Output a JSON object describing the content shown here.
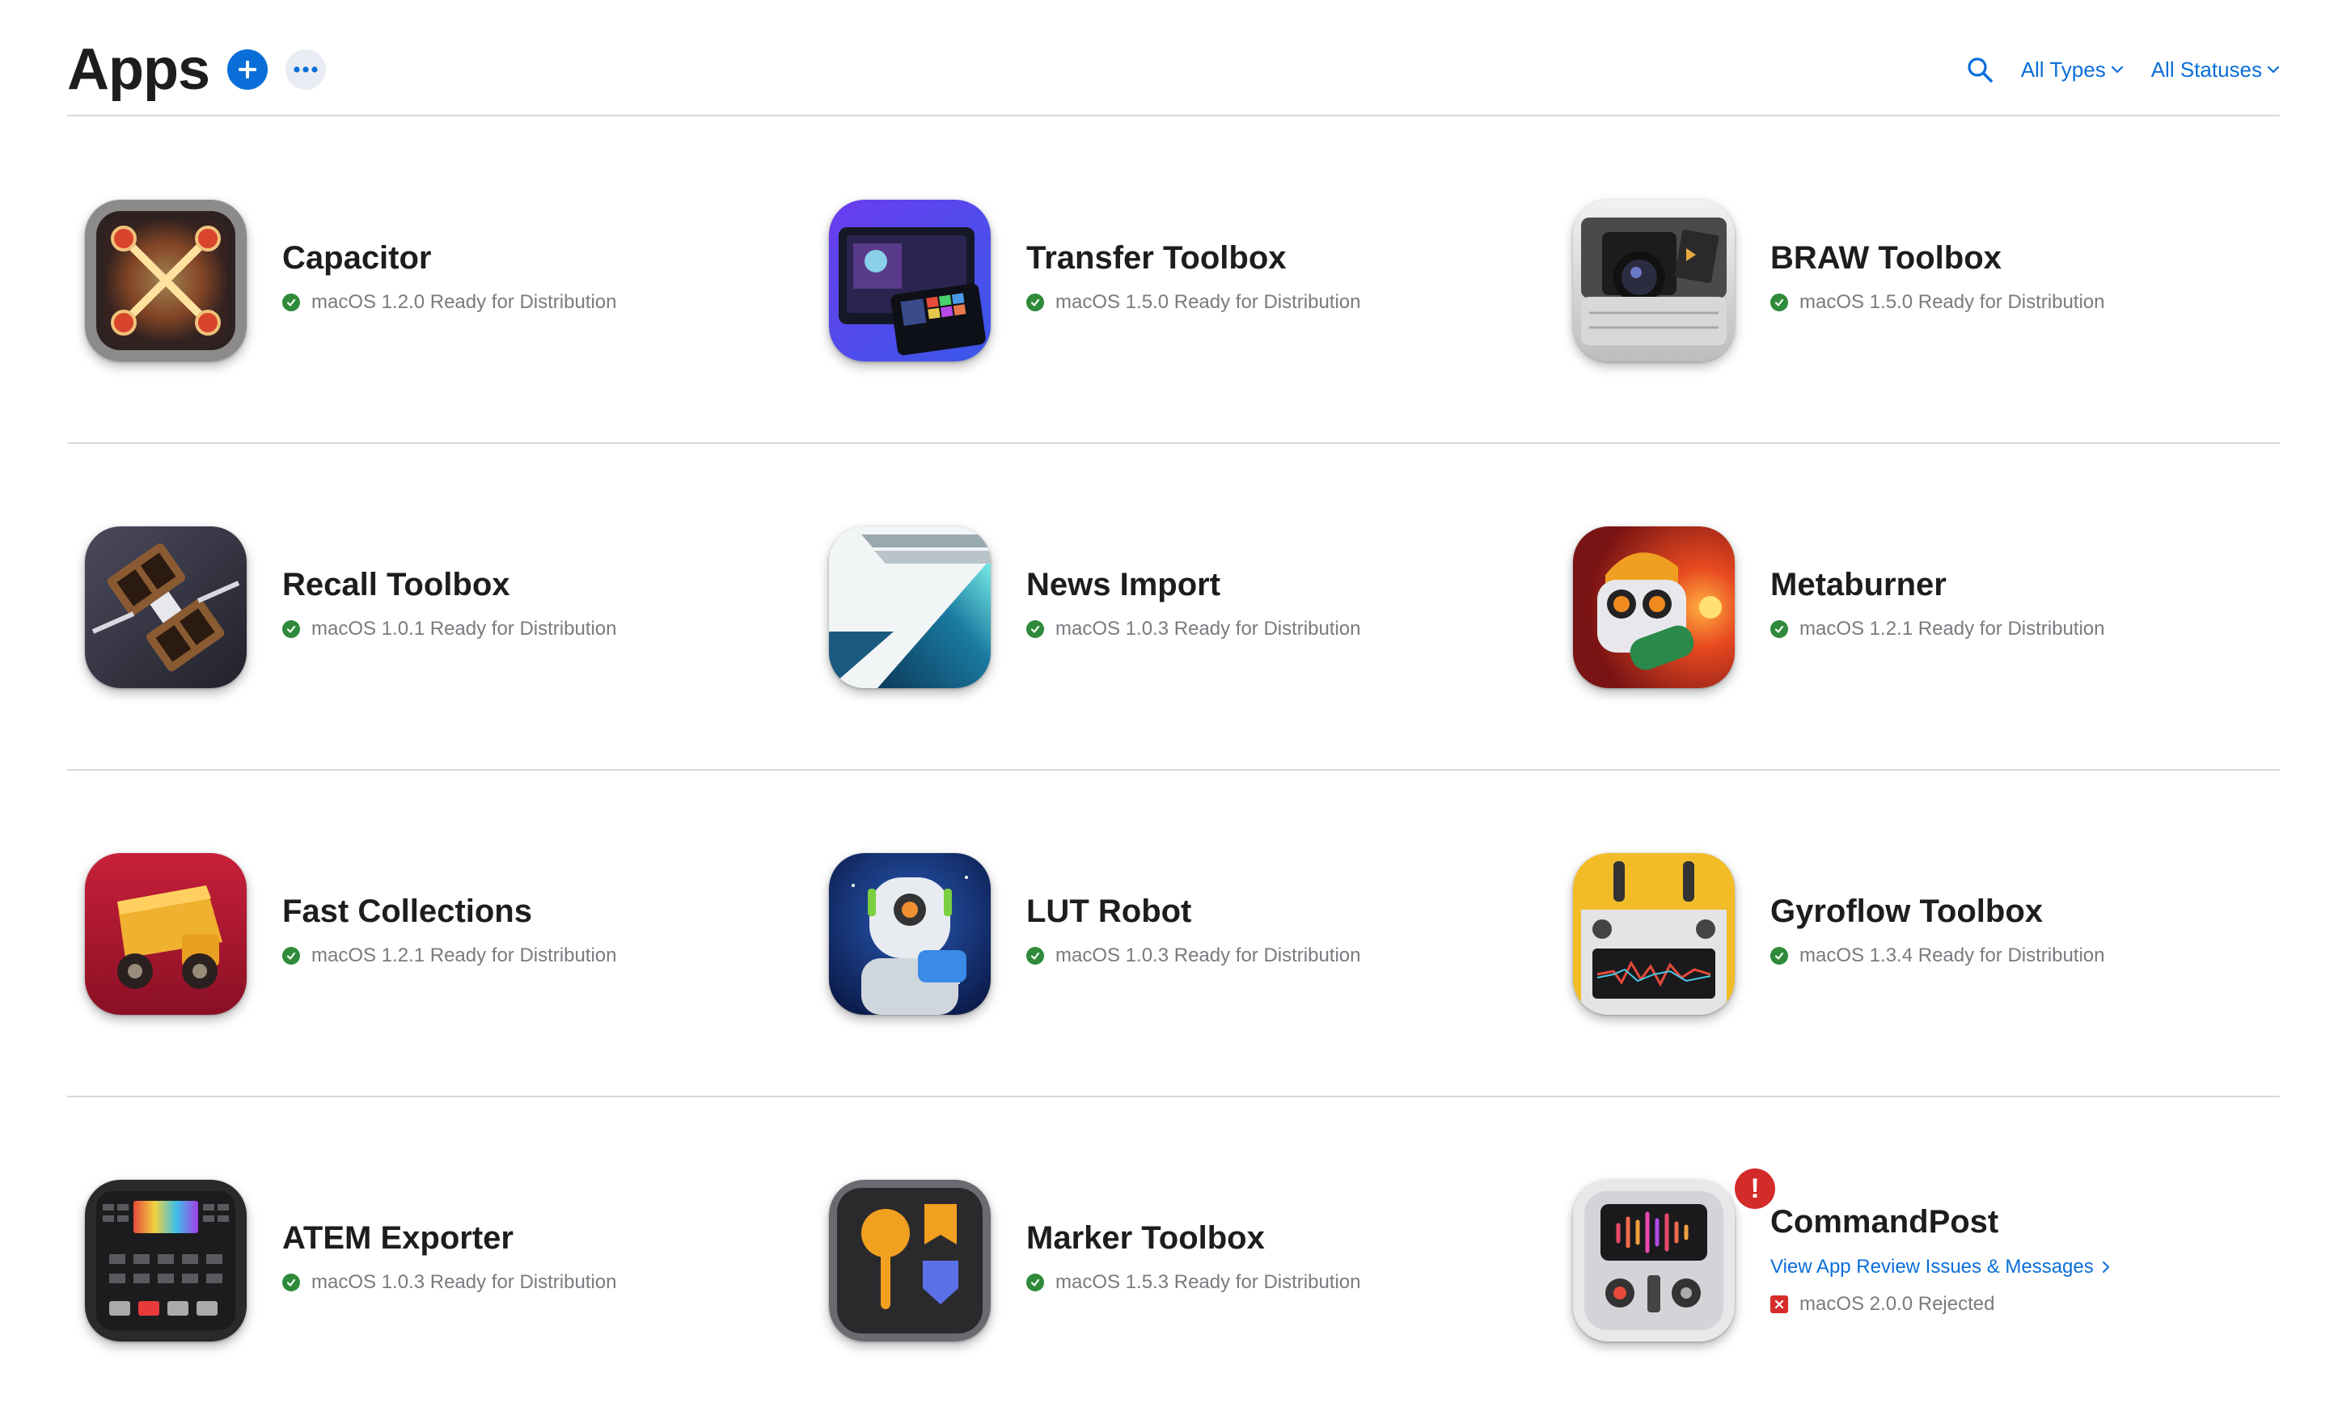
{
  "header": {
    "title": "Apps",
    "add_icon": "plus-circle-icon",
    "more_icon": "ellipsis-icon",
    "search_icon": "magnifying-glass-icon",
    "filters": [
      {
        "label": "All Types"
      },
      {
        "label": "All Statuses"
      }
    ]
  },
  "colors": {
    "accent": "#0a6ed8",
    "ready": "#2f8a3a",
    "rejected": "#d62c2c",
    "divider": "#d9d9de"
  },
  "apps": [
    {
      "name": "Capacitor",
      "status": "macOS 1.2.0 Ready for Distribution",
      "icon": "capacitor-icon"
    },
    {
      "name": "Transfer Toolbox",
      "status": "macOS 1.5.0 Ready for Distribution",
      "icon": "transfer-toolbox-icon"
    },
    {
      "name": "BRAW Toolbox",
      "status": "macOS 1.5.0 Ready for Distribution",
      "icon": "braw-toolbox-icon"
    },
    {
      "name": "Recall Toolbox",
      "status": "macOS 1.0.1 Ready for Distribution",
      "icon": "recall-toolbox-icon"
    },
    {
      "name": "News Import",
      "status": "macOS 1.0.3 Ready for Distribution",
      "icon": "news-import-icon"
    },
    {
      "name": "Metaburner",
      "status": "macOS 1.2.1 Ready for Distribution",
      "icon": "metaburner-icon"
    },
    {
      "name": "Fast Collections",
      "status": "macOS 1.2.1 Ready for Distribution",
      "icon": "fast-collections-icon"
    },
    {
      "name": "LUT Robot",
      "status": "macOS 1.0.3 Ready for Distribution",
      "icon": "lut-robot-icon"
    },
    {
      "name": "Gyroflow Toolbox",
      "status": "macOS 1.3.4 Ready for Distribution",
      "icon": "gyroflow-toolbox-icon"
    },
    {
      "name": "ATEM Exporter",
      "status": "macOS 1.0.3 Ready for Distribution",
      "icon": "atem-exporter-icon"
    },
    {
      "name": "Marker Toolbox",
      "status": "macOS 1.5.3 Ready for Distribution",
      "icon": "marker-toolbox-icon"
    },
    {
      "name": "CommandPost",
      "status": "macOS 2.0.0 Rejected",
      "icon": "commandpost-icon",
      "alert": "!",
      "link": "View App Review Issues & Messages"
    }
  ]
}
